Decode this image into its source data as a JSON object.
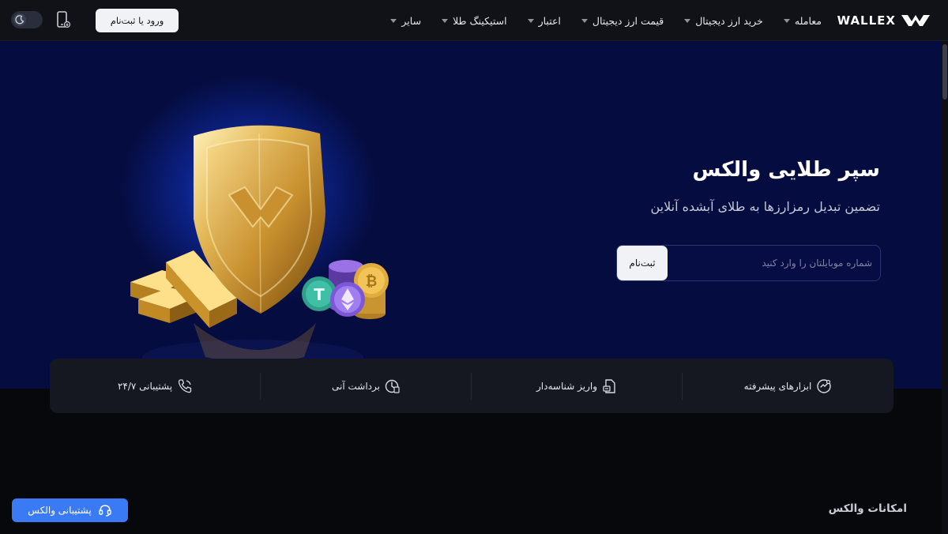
{
  "nav": {
    "logo_text": "WALLEX",
    "items": [
      {
        "label": "معامله",
        "has_dropdown": true
      },
      {
        "label": "خرید ارز دیجیتال",
        "has_dropdown": true
      },
      {
        "label": "قیمت ارز دیجیتال",
        "has_dropdown": true
      },
      {
        "label": "اعتبار",
        "has_dropdown": true
      },
      {
        "label": "استیکینگ طلا",
        "has_dropdown": true
      },
      {
        "label": "سایر",
        "has_dropdown": true
      }
    ],
    "login_label": "ورود یا ثبت‌نام"
  },
  "hero": {
    "title": "سپر طلایی والکس",
    "subtitle": "تضمین تبدیل رمزارزها به طلای آبشده آنلاین",
    "phone_placeholder": "شماره موبایلتان را وارد کنید",
    "phone_value": "",
    "signup_label": "ثبت‌نام"
  },
  "features": [
    {
      "label": "ابزارهای پیشرفته",
      "icon": "tools-icon"
    },
    {
      "label": "واریز شناسه‌دار",
      "icon": "deposit-id-icon"
    },
    {
      "label": "برداشت آنی",
      "icon": "instant-withdraw-icon"
    },
    {
      "label": "پشتیبانی ۲۴/۷",
      "icon": "phone-icon"
    }
  ],
  "section": {
    "title": "امکانات والکس"
  },
  "support_button": {
    "label": "پشتیبانی والکس"
  },
  "colors": {
    "navbar_bg": "#101218",
    "hero_bg": "#050c3f",
    "accent_blue": "#3a7af5",
    "gold": "#d4a64a"
  }
}
